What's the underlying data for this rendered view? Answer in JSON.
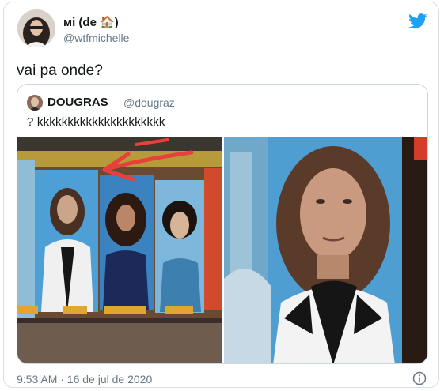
{
  "tweet": {
    "author_name": "мі (de 🏠)",
    "author_handle": "@wtfmichelle",
    "text": "vai pa onde?",
    "timestamp": "9:53 AM · 16 de jul de 2020"
  },
  "quoted": {
    "author_name": "DOUGRAS",
    "author_handle": "@dougraz",
    "text": "? kkkkkkkkkkkkkkkkkkkkk",
    "left_image_nameplates": [
      "",
      "",
      "",
      ""
    ]
  },
  "colors": {
    "twitter_blue": "#1da1f2",
    "arrow_red": "#e8403a",
    "text_primary": "#14171a",
    "text_secondary": "#657786"
  },
  "icons": {
    "brand": "twitter-bird-icon",
    "info": "info-icon"
  }
}
